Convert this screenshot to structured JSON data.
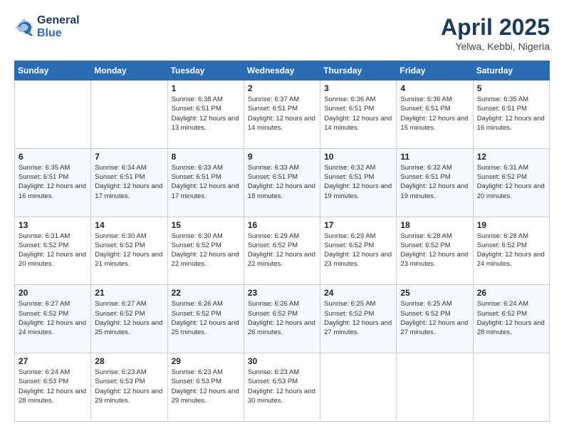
{
  "header": {
    "logo_line1": "General",
    "logo_line2": "Blue",
    "month_title": "April 2025",
    "location": "Yelwa, Kebbi, Nigeria"
  },
  "weekdays": [
    "Sunday",
    "Monday",
    "Tuesday",
    "Wednesday",
    "Thursday",
    "Friday",
    "Saturday"
  ],
  "weeks": [
    [
      {
        "num": "",
        "sunrise": "",
        "sunset": "",
        "daylight": ""
      },
      {
        "num": "",
        "sunrise": "",
        "sunset": "",
        "daylight": ""
      },
      {
        "num": "1",
        "sunrise": "Sunrise: 6:38 AM",
        "sunset": "Sunset: 6:51 PM",
        "daylight": "Daylight: 12 hours and 13 minutes."
      },
      {
        "num": "2",
        "sunrise": "Sunrise: 6:37 AM",
        "sunset": "Sunset: 6:51 PM",
        "daylight": "Daylight: 12 hours and 14 minutes."
      },
      {
        "num": "3",
        "sunrise": "Sunrise: 6:36 AM",
        "sunset": "Sunset: 6:51 PM",
        "daylight": "Daylight: 12 hours and 14 minutes."
      },
      {
        "num": "4",
        "sunrise": "Sunrise: 6:36 AM",
        "sunset": "Sunset: 6:51 PM",
        "daylight": "Daylight: 12 hours and 15 minutes."
      },
      {
        "num": "5",
        "sunrise": "Sunrise: 6:35 AM",
        "sunset": "Sunset: 6:51 PM",
        "daylight": "Daylight: 12 hours and 16 minutes."
      }
    ],
    [
      {
        "num": "6",
        "sunrise": "Sunrise: 6:35 AM",
        "sunset": "Sunset: 6:51 PM",
        "daylight": "Daylight: 12 hours and 16 minutes."
      },
      {
        "num": "7",
        "sunrise": "Sunrise: 6:34 AM",
        "sunset": "Sunset: 6:51 PM",
        "daylight": "Daylight: 12 hours and 17 minutes."
      },
      {
        "num": "8",
        "sunrise": "Sunrise: 6:33 AM",
        "sunset": "Sunset: 6:51 PM",
        "daylight": "Daylight: 12 hours and 17 minutes."
      },
      {
        "num": "9",
        "sunrise": "Sunrise: 6:33 AM",
        "sunset": "Sunset: 6:51 PM",
        "daylight": "Daylight: 12 hours and 18 minutes."
      },
      {
        "num": "10",
        "sunrise": "Sunrise: 6:32 AM",
        "sunset": "Sunset: 6:51 PM",
        "daylight": "Daylight: 12 hours and 19 minutes."
      },
      {
        "num": "11",
        "sunrise": "Sunrise: 6:32 AM",
        "sunset": "Sunset: 6:51 PM",
        "daylight": "Daylight: 12 hours and 19 minutes."
      },
      {
        "num": "12",
        "sunrise": "Sunrise: 6:31 AM",
        "sunset": "Sunset: 6:52 PM",
        "daylight": "Daylight: 12 hours and 20 minutes."
      }
    ],
    [
      {
        "num": "13",
        "sunrise": "Sunrise: 6:31 AM",
        "sunset": "Sunset: 6:52 PM",
        "daylight": "Daylight: 12 hours and 20 minutes."
      },
      {
        "num": "14",
        "sunrise": "Sunrise: 6:30 AM",
        "sunset": "Sunset: 6:52 PM",
        "daylight": "Daylight: 12 hours and 21 minutes."
      },
      {
        "num": "15",
        "sunrise": "Sunrise: 6:30 AM",
        "sunset": "Sunset: 6:52 PM",
        "daylight": "Daylight: 12 hours and 22 minutes."
      },
      {
        "num": "16",
        "sunrise": "Sunrise: 6:29 AM",
        "sunset": "Sunset: 6:52 PM",
        "daylight": "Daylight: 12 hours and 22 minutes."
      },
      {
        "num": "17",
        "sunrise": "Sunrise: 6:29 AM",
        "sunset": "Sunset: 6:52 PM",
        "daylight": "Daylight: 12 hours and 23 minutes."
      },
      {
        "num": "18",
        "sunrise": "Sunrise: 6:28 AM",
        "sunset": "Sunset: 6:52 PM",
        "daylight": "Daylight: 12 hours and 23 minutes."
      },
      {
        "num": "19",
        "sunrise": "Sunrise: 6:28 AM",
        "sunset": "Sunset: 6:52 PM",
        "daylight": "Daylight: 12 hours and 24 minutes."
      }
    ],
    [
      {
        "num": "20",
        "sunrise": "Sunrise: 6:27 AM",
        "sunset": "Sunset: 6:52 PM",
        "daylight": "Daylight: 12 hours and 24 minutes."
      },
      {
        "num": "21",
        "sunrise": "Sunrise: 6:27 AM",
        "sunset": "Sunset: 6:52 PM",
        "daylight": "Daylight: 12 hours and 25 minutes."
      },
      {
        "num": "22",
        "sunrise": "Sunrise: 6:26 AM",
        "sunset": "Sunset: 6:52 PM",
        "daylight": "Daylight: 12 hours and 25 minutes."
      },
      {
        "num": "23",
        "sunrise": "Sunrise: 6:26 AM",
        "sunset": "Sunset: 6:52 PM",
        "daylight": "Daylight: 12 hours and 26 minutes."
      },
      {
        "num": "24",
        "sunrise": "Sunrise: 6:25 AM",
        "sunset": "Sunset: 6:52 PM",
        "daylight": "Daylight: 12 hours and 27 minutes."
      },
      {
        "num": "25",
        "sunrise": "Sunrise: 6:25 AM",
        "sunset": "Sunset: 6:52 PM",
        "daylight": "Daylight: 12 hours and 27 minutes."
      },
      {
        "num": "26",
        "sunrise": "Sunrise: 6:24 AM",
        "sunset": "Sunset: 6:52 PM",
        "daylight": "Daylight: 12 hours and 28 minutes."
      }
    ],
    [
      {
        "num": "27",
        "sunrise": "Sunrise: 6:24 AM",
        "sunset": "Sunset: 6:53 PM",
        "daylight": "Daylight: 12 hours and 28 minutes."
      },
      {
        "num": "28",
        "sunrise": "Sunrise: 6:23 AM",
        "sunset": "Sunset: 6:53 PM",
        "daylight": "Daylight: 12 hours and 29 minutes."
      },
      {
        "num": "29",
        "sunrise": "Sunrise: 6:23 AM",
        "sunset": "Sunset: 6:53 PM",
        "daylight": "Daylight: 12 hours and 29 minutes."
      },
      {
        "num": "30",
        "sunrise": "Sunrise: 6:23 AM",
        "sunset": "Sunset: 6:53 PM",
        "daylight": "Daylight: 12 hours and 30 minutes."
      },
      {
        "num": "",
        "sunrise": "",
        "sunset": "",
        "daylight": ""
      },
      {
        "num": "",
        "sunrise": "",
        "sunset": "",
        "daylight": ""
      },
      {
        "num": "",
        "sunrise": "",
        "sunset": "",
        "daylight": ""
      }
    ]
  ]
}
